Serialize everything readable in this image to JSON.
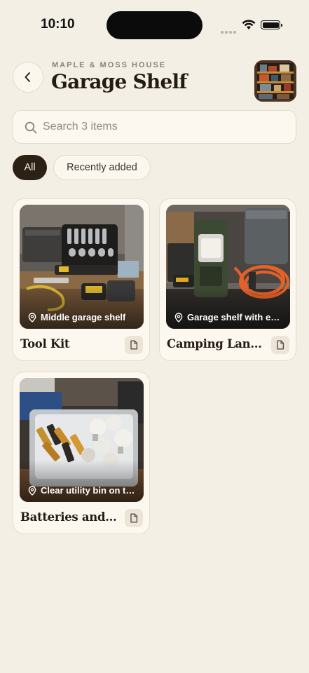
{
  "status_bar": {
    "time": "10:10"
  },
  "header": {
    "eyebrow": "MAPLE & MOSS HOUSE",
    "title": "Garage Shelf",
    "back_icon": "chevron-left-icon"
  },
  "search": {
    "placeholder": "Search 3 items",
    "value": ""
  },
  "filters": [
    {
      "label": "All",
      "selected": true
    },
    {
      "label": "Recently added",
      "selected": false
    }
  ],
  "items": [
    {
      "title": "Tool Kit",
      "location": "Middle garage shelf"
    },
    {
      "title": "Camping Lant…",
      "location": "Garage shelf with e…"
    },
    {
      "title": "Batteries and…",
      "location": "Clear utility bin on t…"
    }
  ],
  "colors": {
    "background": "#f4efe5",
    "chip_active": "#2c2115",
    "card": "#fcf8f0",
    "title": "#241b12"
  }
}
